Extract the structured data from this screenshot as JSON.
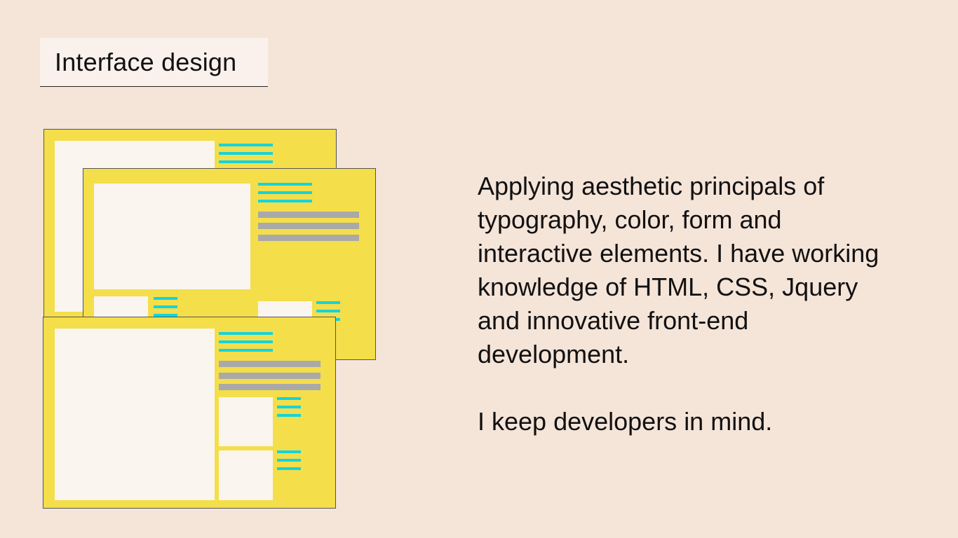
{
  "header": {
    "title": "Interface design"
  },
  "body": {
    "paragraph_1": "Applying aesthetic principals of typography, color, form and interactive elements. I have working knowledge of HTML, CSS, Jquery and innovative front-end development.",
    "paragraph_2": "I keep developers in mind."
  },
  "colors": {
    "background": "#f5e4d8",
    "window": "#f4de4a",
    "pane": "#fbf5ef",
    "accent_lines": "#13d4dc",
    "grey_lines": "#a9a9a9"
  }
}
